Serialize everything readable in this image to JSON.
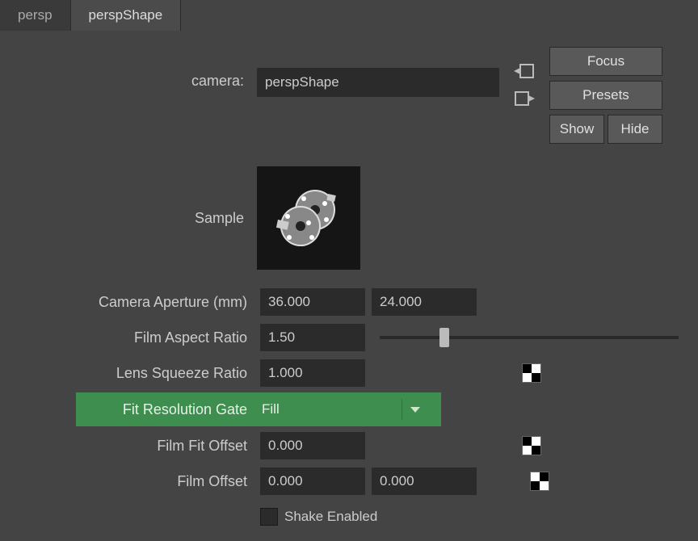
{
  "tabs": {
    "persp": "persp",
    "perspShape": "perspShape"
  },
  "camera": {
    "label": "camera:",
    "value": "perspShape"
  },
  "buttons": {
    "focus": "Focus",
    "presets": "Presets",
    "show": "Show",
    "hide": "Hide"
  },
  "sample": {
    "label": "Sample"
  },
  "attrs": {
    "aperture": {
      "label": "Camera Aperture (mm)",
      "x": "36.000",
      "y": "24.000"
    },
    "filmAspect": {
      "label": "Film Aspect Ratio",
      "value": "1.50"
    },
    "lensSqueeze": {
      "label": "Lens Squeeze Ratio",
      "value": "1.000"
    },
    "fitResGate": {
      "label": "Fit Resolution Gate",
      "value": "Fill"
    },
    "filmFitOffset": {
      "label": "Film Fit Offset",
      "value": "0.000"
    },
    "filmOffset": {
      "label": "Film Offset",
      "x": "0.000",
      "y": "0.000"
    },
    "shakeEnabled": {
      "label": "Shake Enabled"
    }
  }
}
